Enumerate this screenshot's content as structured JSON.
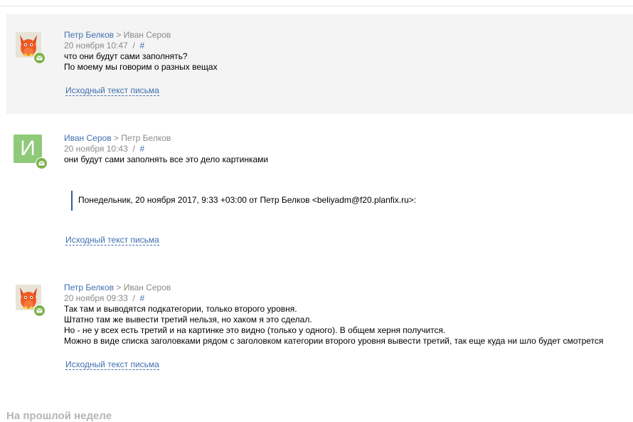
{
  "messages": [
    {
      "author": "Петр Белков",
      "separator": ">",
      "recipient": "Иван Серов",
      "date": "20 ноября 10:47",
      "slash": "/",
      "hash": "#",
      "lines": [
        "что они будут сами заполнять?",
        "По моему мы говорим о разных вещах"
      ],
      "original_link": "Исходный текст письма"
    },
    {
      "author": "Иван Серов",
      "separator": ">",
      "recipient": "Петр Белков",
      "avatar_letter": "И",
      "date": "20 ноября 10:43",
      "slash": "/",
      "hash": "#",
      "lines": [
        "они будут сами заполнять все это дело картинками"
      ],
      "quote": "Понедельник, 20 ноября 2017, 9:33 +03:00 от Петр Белков <beliyadm@f20.planfix.ru>:",
      "original_link": "Исходный текст письма"
    },
    {
      "author": "Петр Белков",
      "separator": ">",
      "recipient": "Иван Серов",
      "date": "20 ноября 09:33",
      "slash": "/",
      "hash": "#",
      "lines": [
        "Так там и выводятся подкатегории, только второго уровня.",
        "Штатно там же вывести третий нельзя, но хаком я это сделал.",
        "Но - не у всех есть третий и на картинке это видно (только у одного). В общем херня получится.",
        "Можно в виде списка заголовками рядом с заголовком категории второго уровня вывести третий, так еще куда ни шло будет смотрется"
      ],
      "original_link": "Исходный текст письма"
    }
  ],
  "bottom_section_title": "На прошлой неделе",
  "icons": {
    "email_badge": "email-icon",
    "avatar_image": "cartoon-avatar"
  },
  "colors": {
    "link": "#3f6fb0",
    "badge": "#7db14b",
    "letter_avatar": "#8fc97a",
    "highlight_bg": "#f4f4f4"
  }
}
